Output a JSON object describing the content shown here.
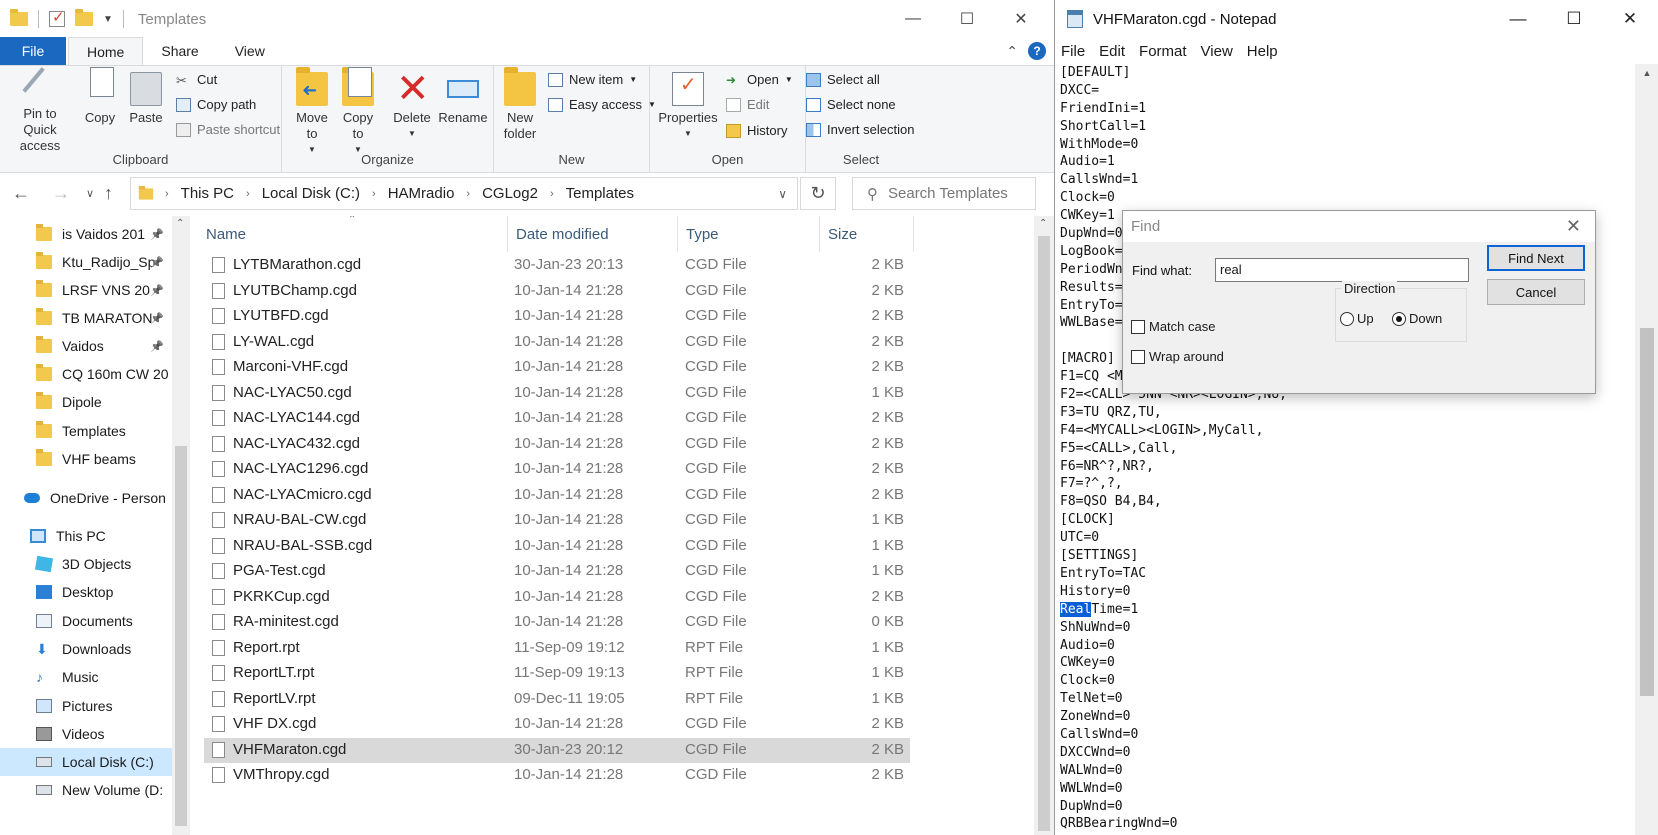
{
  "explorer": {
    "title": "Templates",
    "window_controls": [
      "—",
      "☐",
      "✕"
    ],
    "tabs": {
      "file": "File",
      "home": "Home",
      "share": "Share",
      "view": "View"
    },
    "ribbon": {
      "clipboard": {
        "label": "Clipboard",
        "pin": "Pin to Quick access",
        "copy": "Copy",
        "paste": "Paste",
        "cut": "Cut",
        "copy_path": "Copy path",
        "paste_shortcut": "Paste shortcut"
      },
      "organize": {
        "label": "Organize",
        "move_to": "Move to",
        "copy_to": "Copy to",
        "delete": "Delete",
        "rename": "Rename"
      },
      "new": {
        "label": "New",
        "new_folder": "New folder",
        "new_item": "New item",
        "easy_access": "Easy access"
      },
      "open": {
        "label": "Open",
        "properties": "Properties",
        "open": "Open",
        "edit": "Edit",
        "history": "History"
      },
      "select": {
        "label": "Select",
        "select_all": "Select all",
        "select_none": "Select none",
        "invert": "Invert selection"
      }
    },
    "breadcrumb": [
      "This PC",
      "Local Disk (C:)",
      "HAMradio",
      "CGLog2",
      "Templates"
    ],
    "search_placeholder": "Search Templates",
    "nav_items": [
      {
        "label": "is Vaidos 201",
        "pinned": true,
        "icon": "folder-icon"
      },
      {
        "label": "Ktu_Radijo_Sp",
        "pinned": true,
        "icon": "folder-icon"
      },
      {
        "label": "LRSF VNS 20",
        "pinned": true,
        "icon": "folder-icon"
      },
      {
        "label": "TB MARATON",
        "pinned": true,
        "icon": "folder-icon"
      },
      {
        "label": "Vaidos",
        "pinned": true,
        "icon": "folder-icon"
      },
      {
        "label": "CQ 160m CW 20",
        "pinned": false,
        "icon": "folder-icon"
      },
      {
        "label": "Dipole",
        "pinned": false,
        "icon": "folder-icon"
      },
      {
        "label": "Templates",
        "pinned": false,
        "icon": "folder-icon"
      },
      {
        "label": "VHF beams",
        "pinned": false,
        "icon": "folder-icon"
      },
      {
        "label": "OneDrive - Person",
        "pinned": false,
        "icon": "cloud-icon"
      },
      {
        "label": "This PC",
        "pinned": false,
        "icon": "computer-icon"
      },
      {
        "label": "3D Objects",
        "pinned": false,
        "icon": "cube-icon"
      },
      {
        "label": "Desktop",
        "pinned": false,
        "icon": "desktop-icon"
      },
      {
        "label": "Documents",
        "pinned": false,
        "icon": "documents-icon"
      },
      {
        "label": "Downloads",
        "pinned": false,
        "icon": "download-icon"
      },
      {
        "label": "Music",
        "pinned": false,
        "icon": "music-icon"
      },
      {
        "label": "Pictures",
        "pinned": false,
        "icon": "pictures-icon"
      },
      {
        "label": "Videos",
        "pinned": false,
        "icon": "video-icon"
      },
      {
        "label": "Local Disk (C:)",
        "pinned": false,
        "icon": "drive-icon",
        "selected": true
      },
      {
        "label": "New Volume (D:",
        "pinned": false,
        "icon": "drive-icon"
      }
    ],
    "columns": {
      "name": "Name",
      "date": "Date modified",
      "type": "Type",
      "size": "Size"
    },
    "files": [
      {
        "name": "LYTBMarathon.cgd",
        "date": "30-Jan-23 20:13",
        "type": "CGD File",
        "size": "2 KB"
      },
      {
        "name": "LYUTBChamp.cgd",
        "date": "10-Jan-14 21:28",
        "type": "CGD File",
        "size": "2 KB"
      },
      {
        "name": "LYUTBFD.cgd",
        "date": "10-Jan-14 21:28",
        "type": "CGD File",
        "size": "2 KB"
      },
      {
        "name": "LY-WAL.cgd",
        "date": "10-Jan-14 21:28",
        "type": "CGD File",
        "size": "2 KB"
      },
      {
        "name": "Marconi-VHF.cgd",
        "date": "10-Jan-14 21:28",
        "type": "CGD File",
        "size": "2 KB"
      },
      {
        "name": "NAC-LYAC50.cgd",
        "date": "10-Jan-14 21:28",
        "type": "CGD File",
        "size": "1 KB"
      },
      {
        "name": "NAC-LYAC144.cgd",
        "date": "10-Jan-14 21:28",
        "type": "CGD File",
        "size": "2 KB"
      },
      {
        "name": "NAC-LYAC432.cgd",
        "date": "10-Jan-14 21:28",
        "type": "CGD File",
        "size": "2 KB"
      },
      {
        "name": "NAC-LYAC1296.cgd",
        "date": "10-Jan-14 21:28",
        "type": "CGD File",
        "size": "2 KB"
      },
      {
        "name": "NAC-LYACmicro.cgd",
        "date": "10-Jan-14 21:28",
        "type": "CGD File",
        "size": "2 KB"
      },
      {
        "name": "NRAU-BAL-CW.cgd",
        "date": "10-Jan-14 21:28",
        "type": "CGD File",
        "size": "1 KB"
      },
      {
        "name": "NRAU-BAL-SSB.cgd",
        "date": "10-Jan-14 21:28",
        "type": "CGD File",
        "size": "1 KB"
      },
      {
        "name": "PGA-Test.cgd",
        "date": "10-Jan-14 21:28",
        "type": "CGD File",
        "size": "1 KB"
      },
      {
        "name": "PKRKCup.cgd",
        "date": "10-Jan-14 21:28",
        "type": "CGD File",
        "size": "2 KB"
      },
      {
        "name": "RA-minitest.cgd",
        "date": "10-Jan-14 21:28",
        "type": "CGD File",
        "size": "0 KB"
      },
      {
        "name": "Report.rpt",
        "date": "11-Sep-09 19:12",
        "type": "RPT File",
        "size": "1 KB"
      },
      {
        "name": "ReportLT.rpt",
        "date": "11-Sep-09 19:13",
        "type": "RPT File",
        "size": "1 KB"
      },
      {
        "name": "ReportLV.rpt",
        "date": "09-Dec-11 19:05",
        "type": "RPT File",
        "size": "1 KB"
      },
      {
        "name": "VHF DX.cgd",
        "date": "10-Jan-14 21:28",
        "type": "CGD File",
        "size": "2 KB"
      },
      {
        "name": "VHFMaraton.cgd",
        "date": "30-Jan-23 20:12",
        "type": "CGD File",
        "size": "2 KB",
        "selected": true
      },
      {
        "name": "VMThropy.cgd",
        "date": "10-Jan-14 21:28",
        "type": "CGD File",
        "size": "2 KB"
      }
    ]
  },
  "notepad": {
    "title": "VHFMaraton.cgd - Notepad",
    "window_controls": [
      "—",
      "☐",
      "✕"
    ],
    "menu": [
      "File",
      "Edit",
      "Format",
      "View",
      "Help"
    ],
    "lines": [
      "[DEFAULT]",
      "DXCC=",
      "FriendIni=1",
      "ShortCall=1",
      "WithMode=0",
      "Audio=1",
      "CallsWnd=1",
      "Clock=0",
      "CWKey=1",
      "DupWnd=0",
      "LogBook=",
      "PeriodWn",
      "Results=",
      "EntryTo=",
      "WWLBase=",
      "",
      "[MACRO]",
      "F1=CQ <M",
      "F2=<CALL> 5NN <NR><LOGIN>,NU,",
      "F3=TU QRZ,TU,",
      "F4=<MYCALL><LOGIN>,MyCall,",
      "F5=<CALL>,Call,",
      "F6=NR^?,NR?,",
      "F7=?^,?,",
      "F8=QSO B4,B4,",
      "[CLOCK]",
      "UTC=0",
      "[SETTINGS]",
      "EntryTo=TAC",
      "History=0",
      "RealTime=1",
      "ShNuWnd=0",
      "Audio=0",
      "CWKey=0",
      "Clock=0",
      "TelNet=0",
      "ZoneWnd=0",
      "CallsWnd=0",
      "DXCCWnd=0",
      "WALWnd=0",
      "WWLWnd=0",
      "DupWnd=0",
      "QRBBearingWnd=0"
    ],
    "highlight": {
      "line": 30,
      "text": "Real",
      "rest": "Time=1"
    }
  },
  "find_dialog": {
    "title": "Find",
    "find_what_label": "Find what:",
    "find_what_value": "real",
    "find_next": "Find Next",
    "cancel": "Cancel",
    "direction_label": "Direction",
    "up": "Up",
    "down": "Down",
    "direction_selected": "Down",
    "match_case": "Match case",
    "match_case_checked": false,
    "wrap_around": "Wrap around",
    "wrap_around_checked": false
  },
  "colors": {
    "accent": "#1a68c0",
    "selection": "#0a5fd6",
    "selected_row": "#d9d9d9"
  }
}
